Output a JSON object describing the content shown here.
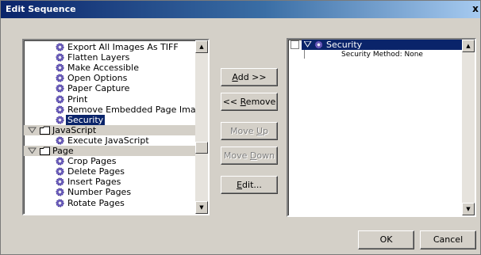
{
  "window": {
    "title": "Edit Sequence",
    "close_glyph": "x"
  },
  "left_tree": {
    "rows": [
      {
        "label": "Export All Images As TIFF",
        "kind": "item",
        "selected": false,
        "icon": "gear-icon"
      },
      {
        "label": "Flatten Layers",
        "kind": "item",
        "selected": false,
        "icon": "gear-icon"
      },
      {
        "label": "Make Accessible",
        "kind": "item",
        "selected": false,
        "icon": "gear-icon"
      },
      {
        "label": "Open Options",
        "kind": "item",
        "selected": false,
        "icon": "gear-icon"
      },
      {
        "label": "Paper Capture",
        "kind": "item",
        "selected": false,
        "icon": "gear-icon"
      },
      {
        "label": "Print",
        "kind": "item",
        "selected": false,
        "icon": "gear-icon"
      },
      {
        "label": "Remove Embedded Page Images",
        "kind": "item",
        "selected": false,
        "icon": "gear-icon"
      },
      {
        "label": "Security",
        "kind": "item",
        "selected": true,
        "icon": "gear-icon"
      },
      {
        "label": "JavaScript",
        "kind": "group",
        "selected": false,
        "icon": "folder-icon"
      },
      {
        "label": "Execute JavaScript",
        "kind": "item",
        "selected": false,
        "icon": "gear-icon"
      },
      {
        "label": "Page",
        "kind": "group",
        "selected": false,
        "icon": "folder-icon"
      },
      {
        "label": "Crop Pages",
        "kind": "item",
        "selected": false,
        "icon": "gear-icon"
      },
      {
        "label": "Delete Pages",
        "kind": "item",
        "selected": false,
        "icon": "gear-icon"
      },
      {
        "label": "Insert Pages",
        "kind": "item",
        "selected": false,
        "icon": "gear-icon"
      },
      {
        "label": "Number Pages",
        "kind": "item",
        "selected": false,
        "icon": "gear-icon"
      },
      {
        "label": "Rotate Pages",
        "kind": "item",
        "selected": false,
        "icon": "gear-icon"
      }
    ]
  },
  "buttons": {
    "add": {
      "pre": "",
      "key": "A",
      "post": "dd >>"
    },
    "remove": {
      "pre": "<< ",
      "key": "R",
      "post": "emove"
    },
    "move_up": {
      "pre": "Move ",
      "key": "U",
      "post": "p"
    },
    "move_down": {
      "pre": "Move ",
      "key": "D",
      "post": "own"
    },
    "edit": {
      "pre": "",
      "key": "E",
      "post": "dit..."
    },
    "ok": "OK",
    "cancel": "Cancel"
  },
  "right_list": {
    "item_label": "Security",
    "detail": "Security Method: None"
  },
  "colors": {
    "selection": "#0a246a",
    "dialog_face": "#d4d0c8",
    "disabled_text": "#808080"
  }
}
